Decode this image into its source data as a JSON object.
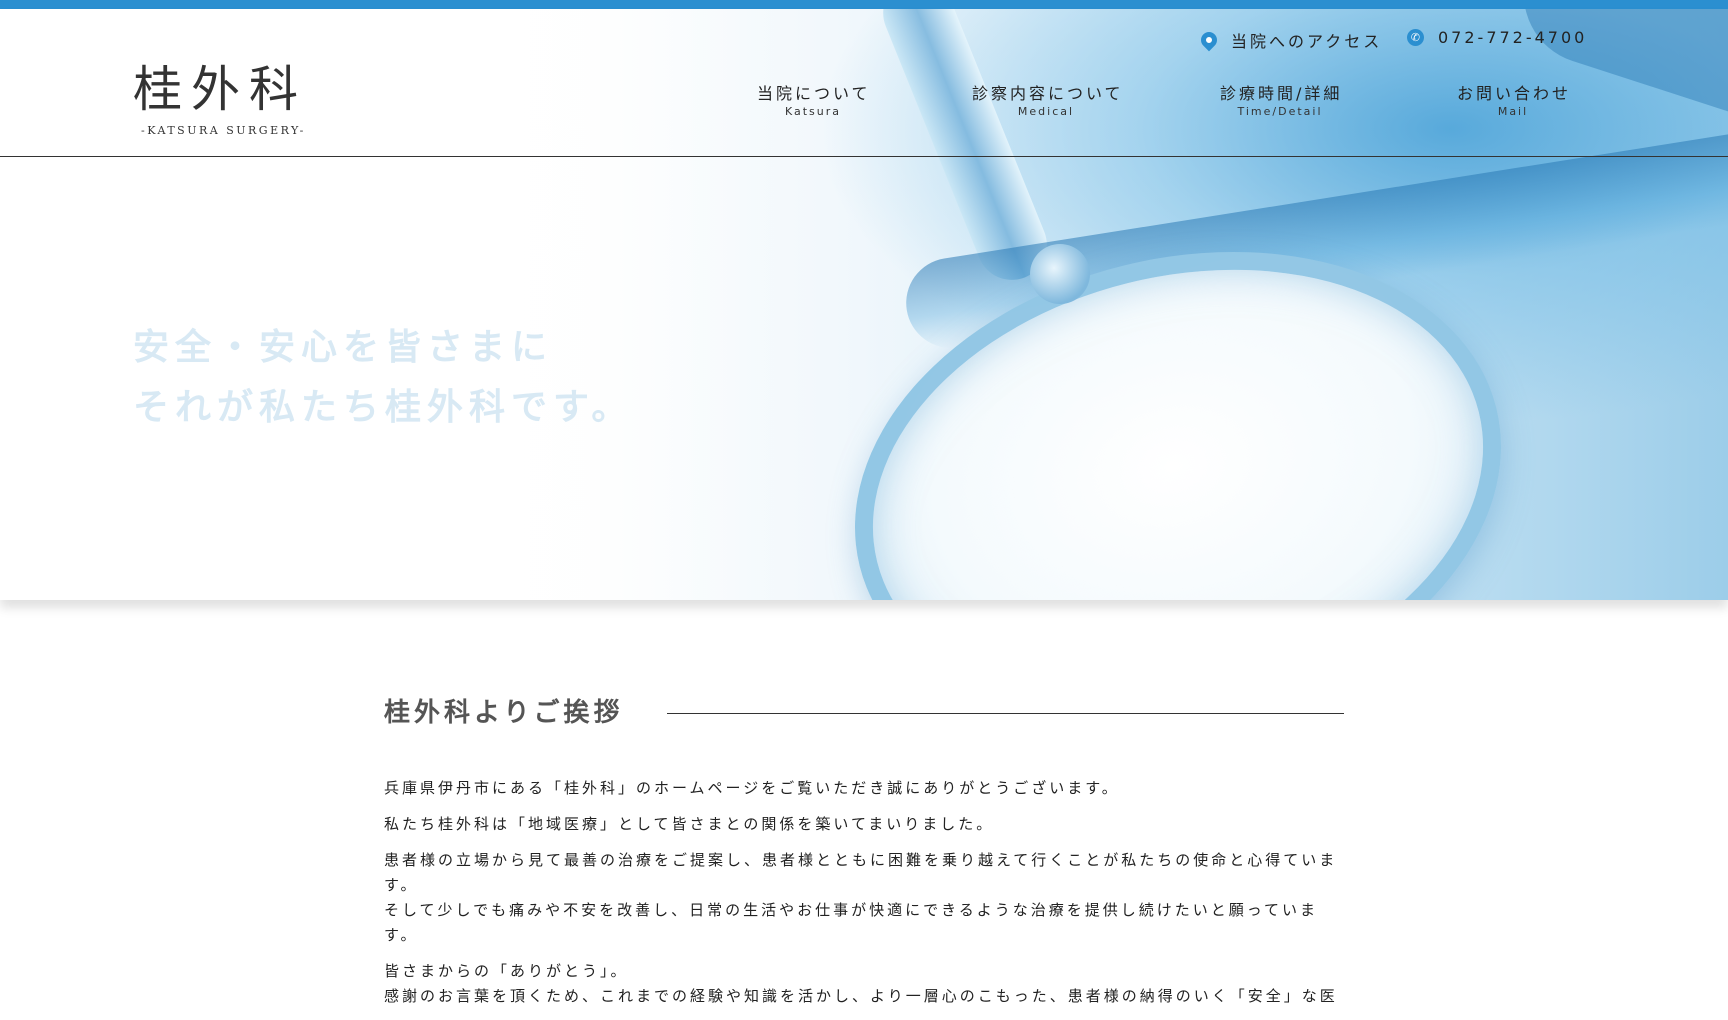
{
  "colors": {
    "accent": "#2b8fd0",
    "text": "#333333",
    "hero_text": "#d8e9f4"
  },
  "header": {
    "logo_main": "桂外科",
    "logo_sub": "-KATSURA SURGERY-",
    "access_label": "当院へのアクセス",
    "access_icon": "map-pin-icon",
    "phone_label": "072-772-4700",
    "phone_icon": "phone-icon",
    "nav": [
      {
        "ja": "当院について",
        "en": "Katsura"
      },
      {
        "ja": "診察内容について",
        "en": "Medical"
      },
      {
        "ja": "診療時間/詳細",
        "en": "Time/Detail"
      },
      {
        "ja": "お問い合わせ",
        "en": "Mail"
      }
    ]
  },
  "hero": {
    "line1": "安全・安心を皆さまに",
    "line2": "それが私たち桂外科です。"
  },
  "greeting": {
    "title": "桂外科よりご挨拶",
    "paragraphs": [
      "兵庫県伊丹市にある「桂外科」のホームページをご覧いただき誠にありがとうございます。",
      "私たち桂外科は「地域医療」として皆さまとの関係を築いてまいりました。",
      "患者様の立場から見て最善の治療をご提案し、患者様とともに困難を乗り越えて行くことが私たちの使命と心得ています。",
      "そして少しでも痛みや不安を改善し、日常の生活やお仕事が快適にできるような治療を提供し続けたいと願っています。",
      "皆さまからの「ありがとう」。",
      "感謝のお言葉を頂くため、これまでの経験や知識を活かし、より一層心のこもった、患者様の納得のいく「安全」な医"
    ]
  }
}
